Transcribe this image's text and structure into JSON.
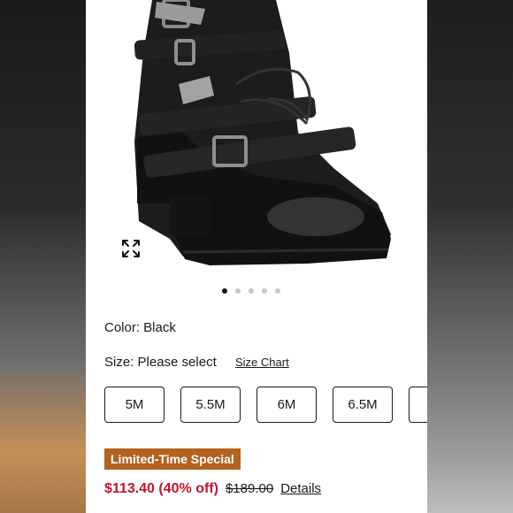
{
  "product": {
    "dots_count": 5,
    "active_dot_index": 0,
    "expand_icon": "expand-arrows-icon"
  },
  "color": {
    "label": "Color: Black"
  },
  "size": {
    "label": "Size: Please select",
    "size_chart_link": "Size Chart",
    "options": [
      "5M",
      "5.5M",
      "6M",
      "6.5M"
    ]
  },
  "promo": {
    "badge": "Limited-Time Special"
  },
  "price": {
    "sale": "$113.40 (40% off)",
    "original": "$189.00",
    "details_link": "Details"
  },
  "colors": {
    "sale_red": "#c4132d",
    "badge_orange": "#b4621f"
  }
}
